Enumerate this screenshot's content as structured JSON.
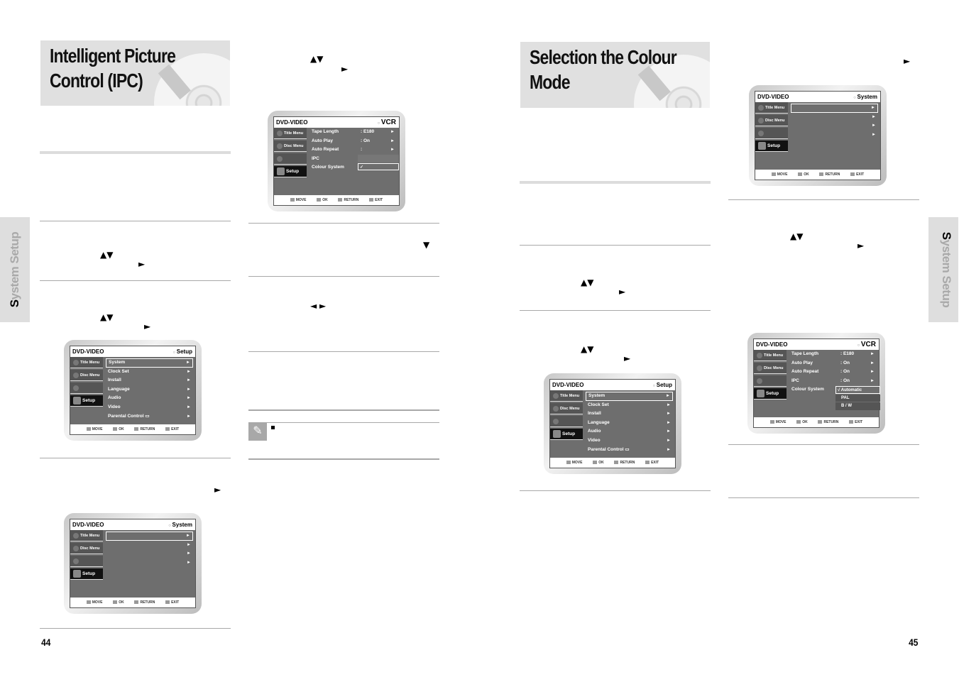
{
  "left_page": {
    "title": "Intelligent Picture Control (IPC)",
    "title_line1": "Intelligent Picture",
    "title_line2": "Control (IPC)",
    "side_tab": {
      "cap": "S",
      "rest": "ystem Setup"
    },
    "page_number": "44",
    "glyphs": {
      "updown": "▲▼",
      "right": "►",
      "down": "▼",
      "leftright": "◄ ►",
      "note_bullet": "■"
    }
  },
  "right_page": {
    "title": "Selection the Colour Mode",
    "title_line1": "Selection the Colour",
    "title_line2": "Mode",
    "side_tab": {
      "cap": "S",
      "rest": "ystem Setup"
    },
    "page_number": "45"
  },
  "osd": {
    "brand": "DVD-VIDEO",
    "footer": {
      "move": "MOVE",
      "ok": "OK",
      "return": "RETURN",
      "exit": "EXIT"
    },
    "side_tabs": [
      "Title Menu",
      "Disc Menu",
      "",
      "Setup"
    ],
    "setup_screen": {
      "mode": "Setup",
      "items": [
        "System",
        "Clock Set",
        "Install",
        "Language",
        "Audio",
        "Video",
        "Parental Control"
      ]
    },
    "system_screen": {
      "mode": "System",
      "items": [
        "",
        "",
        "",
        ""
      ]
    },
    "vcr_screen_ipc": {
      "mode": "VCR",
      "items": [
        {
          "label": "Tape Length",
          "value": ": E180",
          "arrow": true
        },
        {
          "label": "Auto Play",
          "value": ": On",
          "arrow": true
        },
        {
          "label": "Auto Repeat",
          "value": ":",
          "arrow": true
        },
        {
          "label": "IPC",
          "value": "",
          "arrow": false
        },
        {
          "label": "Colour System",
          "value": "",
          "arrow": false
        }
      ],
      "dropdown": [
        "",
        "✓"
      ]
    },
    "vcr_screen_colour": {
      "mode": "VCR",
      "items": [
        {
          "label": "Tape Length",
          "value": ": E180",
          "arrow": true
        },
        {
          "label": "Auto Play",
          "value": ": On",
          "arrow": true
        },
        {
          "label": "Auto Repeat",
          "value": ": On",
          "arrow": true
        },
        {
          "label": "IPC",
          "value": ": On",
          "arrow": true
        },
        {
          "label": "Colour System",
          "value": "",
          "arrow": false
        }
      ],
      "dropdown": [
        "√ Automatic",
        "PAL",
        "B / W"
      ]
    }
  }
}
